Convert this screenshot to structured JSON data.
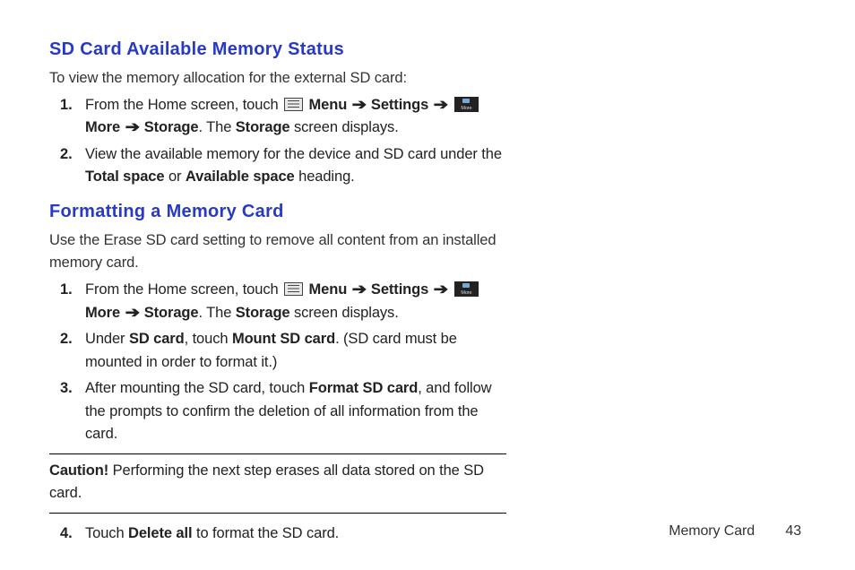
{
  "section1": {
    "heading": "SD Card Available Memory Status",
    "intro": "To view the memory allocation for the external SD card:",
    "steps": {
      "s1": {
        "num": "1.",
        "a": "From the Home screen, touch ",
        "menu": "Menu",
        "settings": "Settings",
        "more": "More",
        "storage": "Storage",
        "b": ". The ",
        "storage2": "Storage",
        "c": " screen displays."
      },
      "s2": {
        "num": "2.",
        "a": "View the available memory for the device and SD card under the ",
        "total": "Total space",
        "or": " or ",
        "avail": "Available space",
        "b": " heading."
      }
    }
  },
  "section2": {
    "heading": "Formatting a Memory Card",
    "intro": "Use the Erase SD card setting to remove all content from an installed memory card.",
    "steps": {
      "s1": {
        "num": "1.",
        "a": "From the Home screen, touch ",
        "menu": "Menu",
        "settings": "Settings",
        "more": "More",
        "storage": "Storage",
        "b": ". The ",
        "storage2": "Storage",
        "c": " screen displays."
      },
      "s2": {
        "num": "2.",
        "a": "Under ",
        "sdcard": "SD card",
        "b": ", touch ",
        "mount": "Mount SD card",
        "c": ". (SD card must be mounted in order to format it.)"
      },
      "s3": {
        "num": "3.",
        "a": "After mounting the SD card, touch ",
        "format": "Format SD card",
        "b": ", and follow the prompts to confirm the deletion of all information from the card."
      },
      "s4": {
        "num": "4.",
        "a": "Touch ",
        "del": "Delete all",
        "b": " to format the SD card."
      }
    },
    "caution": {
      "label": "Caution!",
      "text": " Performing the next step erases all data stored on the SD card."
    }
  },
  "arrow": "➔",
  "footer": {
    "section": "Memory Card",
    "page": "43"
  }
}
